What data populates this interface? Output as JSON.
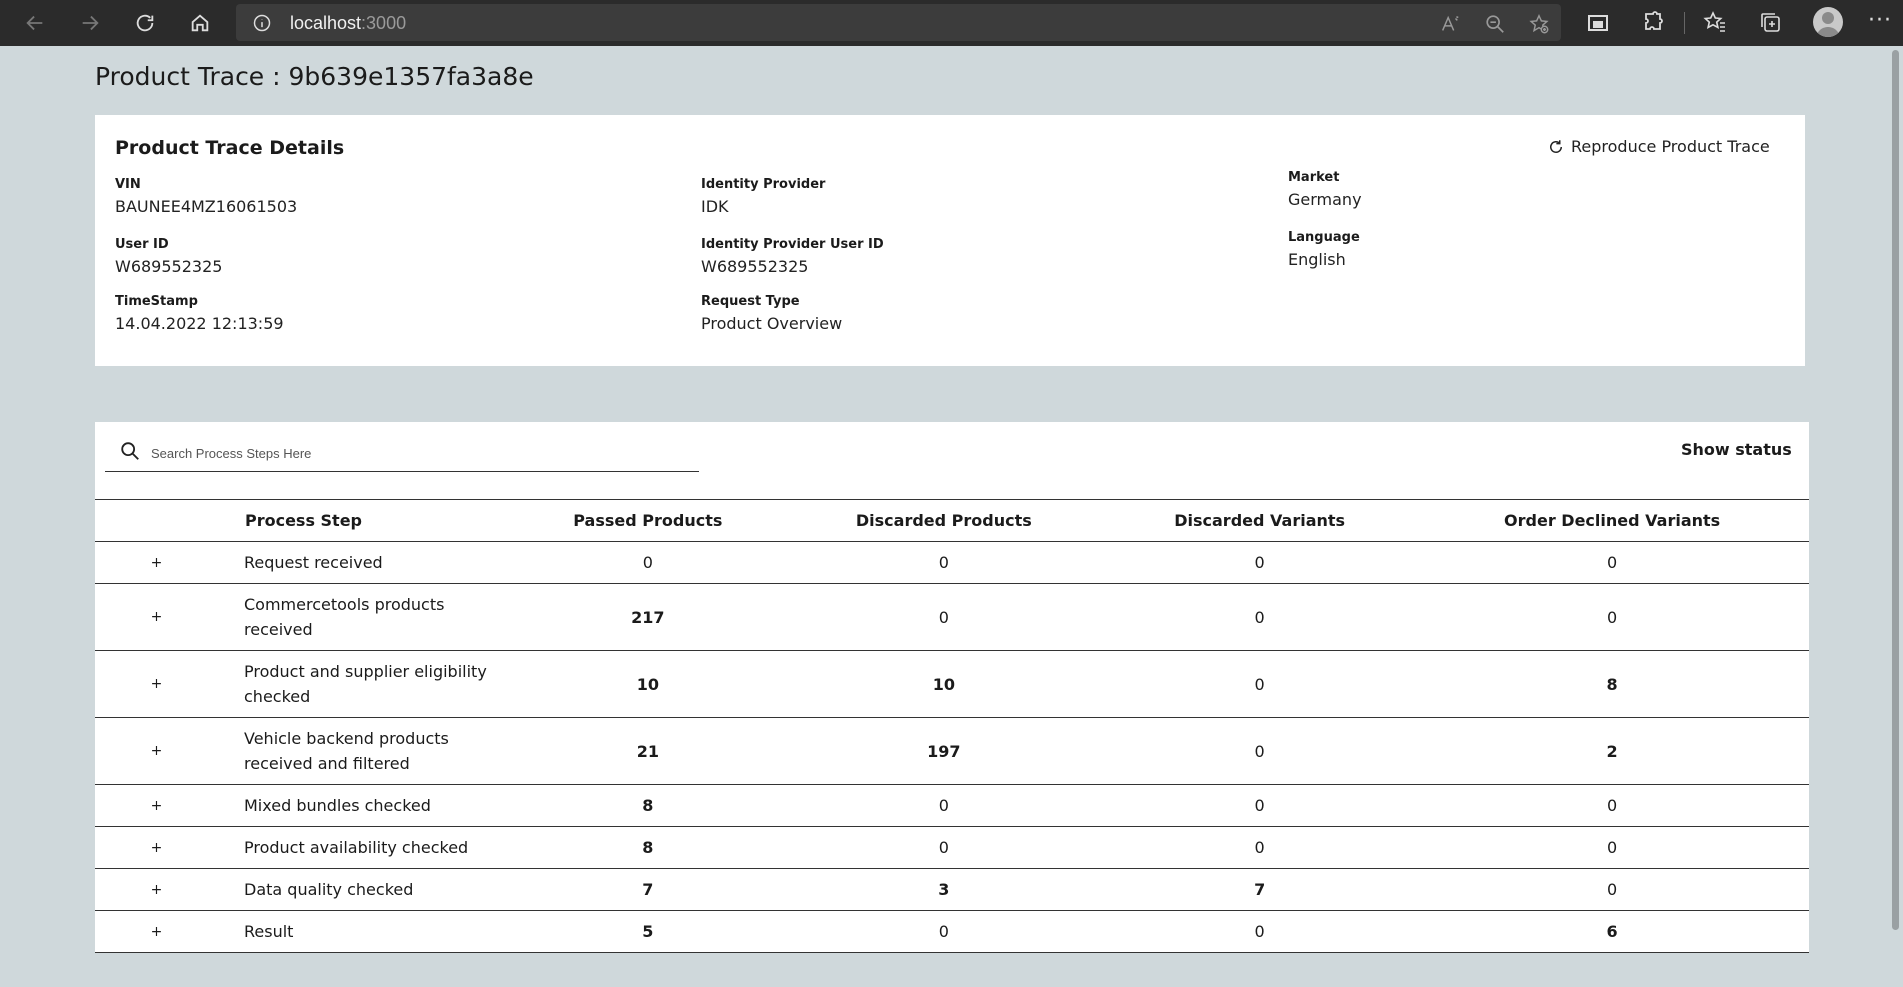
{
  "browser": {
    "address_host": "localhost",
    "address_port": ":3000",
    "more_label": "···"
  },
  "page": {
    "title": "Product Trace : 9b639e1357fa3a8e"
  },
  "details": {
    "title": "Product Trace Details",
    "reproduce_label": "Reproduce Product Trace",
    "vin_label": "VIN",
    "vin_value": "BAUNEE4MZ16061503",
    "user_id_label": "User ID",
    "user_id_value": "W689552325",
    "timestamp_label": "TimeStamp",
    "timestamp_value": "14.04.2022 12:13:59",
    "identity_provider_label": "Identity Provider",
    "identity_provider_value": "IDK",
    "idp_user_id_label": "Identity Provider User ID",
    "idp_user_id_value": "W689552325",
    "request_type_label": "Request Type",
    "request_type_value": "Product Overview",
    "market_label": "Market",
    "market_value": "Germany",
    "language_label": "Language",
    "language_value": "English"
  },
  "steps": {
    "search_placeholder": "Search Process Steps Here",
    "show_status_label": "Show status",
    "columns": [
      "Process Step",
      "Passed Products",
      "Discarded Products",
      "Discarded Variants",
      "Order Declined Variants"
    ],
    "expand_symbol": "+",
    "rows": [
      {
        "step": "Request received",
        "passed": "0",
        "discarded": "0",
        "discarded_variants": "0",
        "order_declined": "0",
        "tall": false
      },
      {
        "step": "Commercetools products received",
        "passed": "217",
        "discarded": "0",
        "discarded_variants": "0",
        "order_declined": "0",
        "tall": true
      },
      {
        "step": "Product and supplier eligibility checked",
        "passed": "10",
        "discarded": "10",
        "discarded_variants": "0",
        "order_declined": "8",
        "tall": true
      },
      {
        "step": "Vehicle backend products received and filtered",
        "passed": "21",
        "discarded": "197",
        "discarded_variants": "0",
        "order_declined": "2",
        "tall": true
      },
      {
        "step": "Mixed bundles checked",
        "passed": "8",
        "discarded": "0",
        "discarded_variants": "0",
        "order_declined": "0",
        "tall": false
      },
      {
        "step": "Product availability checked",
        "passed": "8",
        "discarded": "0",
        "discarded_variants": "0",
        "order_declined": "0",
        "tall": false
      },
      {
        "step": "Data quality checked",
        "passed": "7",
        "discarded": "3",
        "discarded_variants": "7",
        "order_declined": "0",
        "tall": false
      },
      {
        "step": "Result",
        "passed": "5",
        "discarded": "0",
        "discarded_variants": "0",
        "order_declined": "6",
        "tall": false
      }
    ]
  }
}
